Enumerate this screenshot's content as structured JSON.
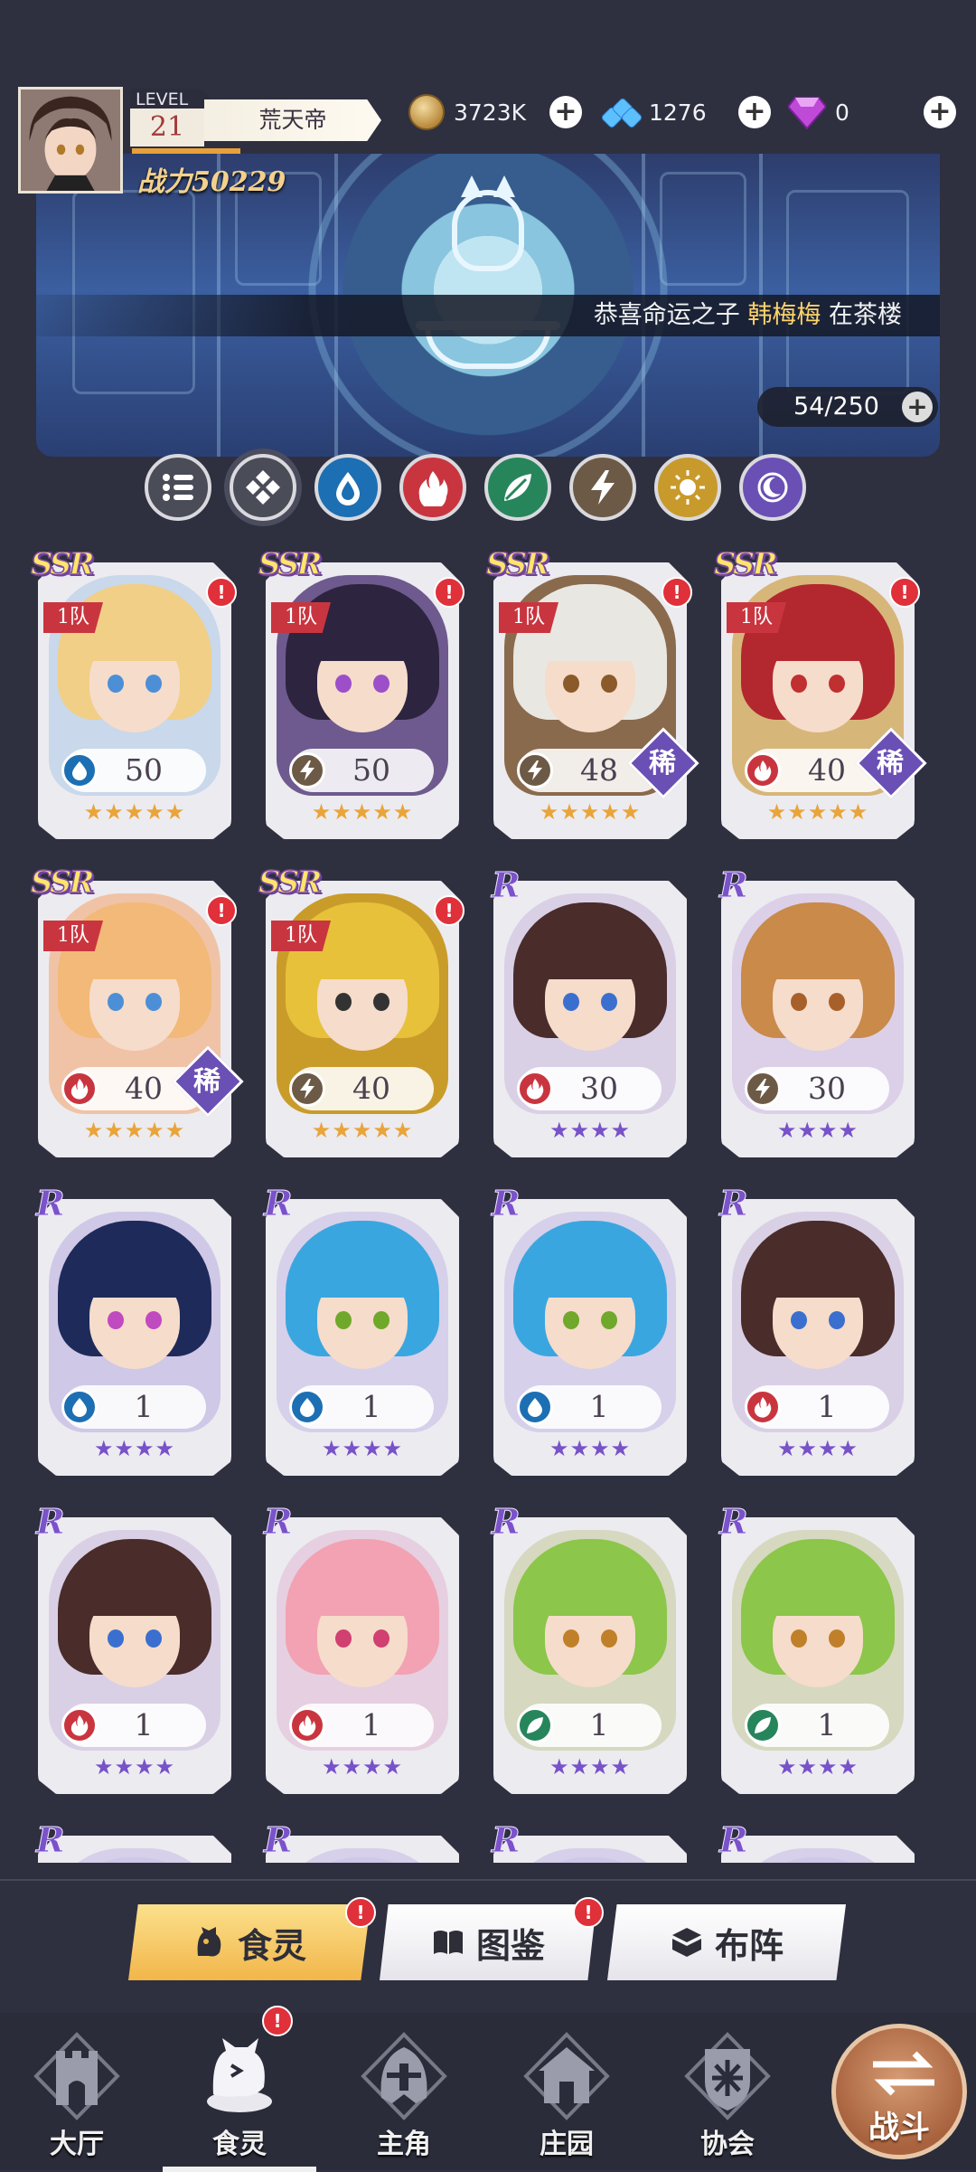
{
  "player": {
    "level_label": "LEVEL",
    "level": "21",
    "name": "荒天帝",
    "power": "战力50229"
  },
  "resources": [
    {
      "icon": "gold-coin-icon",
      "value": "3723K"
    },
    {
      "icon": "blue-crystal-icon",
      "value": "1276"
    },
    {
      "icon": "purple-diamond-icon",
      "value": "0"
    }
  ],
  "announcement": {
    "prefix": "恭喜命运之子 ",
    "highlight": "韩梅梅",
    "suffix": " 在茶楼"
  },
  "collection_count": "54/250",
  "filters": [
    {
      "name": "filter-all",
      "icon": "list-icon",
      "color": "#4a4c58"
    },
    {
      "name": "filter-diamond",
      "icon": "diamond-grid-icon",
      "color": "#4a4c58",
      "active": true
    },
    {
      "name": "filter-water",
      "icon": "water-drop-icon",
      "color": "#1d6fb3"
    },
    {
      "name": "filter-fire",
      "icon": "fire-icon",
      "color": "#c9353f"
    },
    {
      "name": "filter-leaf",
      "icon": "leaf-icon",
      "color": "#27855c"
    },
    {
      "name": "filter-lightning",
      "icon": "lightning-icon",
      "color": "#6d5a46"
    },
    {
      "name": "filter-sun",
      "icon": "sun-icon",
      "color": "#c89a2c"
    },
    {
      "name": "filter-moon",
      "icon": "moon-icon",
      "color": "#6a4fb5"
    }
  ],
  "cards": [
    {
      "rarity": "SSR",
      "team": "1队",
      "alert": "!",
      "level": "50",
      "element": "water",
      "rare": "",
      "stars": "★★★★★",
      "hair": "#f1cf86",
      "eye": "#4c8fd6",
      "bg": "#c9d8ea"
    },
    {
      "rarity": "SSR",
      "team": "1队",
      "alert": "!",
      "level": "50",
      "element": "lightning",
      "rare": "",
      "stars": "★★★★★",
      "hair": "#2d2440",
      "eye": "#9c4fc8",
      "bg": "#6e5a8e"
    },
    {
      "rarity": "SSR",
      "team": "1队",
      "alert": "!",
      "level": "48",
      "element": "lightning",
      "rare": "稀",
      "stars": "★★★★★",
      "hair": "#e9e7e2",
      "eye": "#8a5a2a",
      "bg": "#8a6a4c"
    },
    {
      "rarity": "SSR",
      "team": "1队",
      "alert": "!",
      "level": "40",
      "element": "fire",
      "rare": "稀",
      "stars": "★★★★★",
      "hair": "#b3282e",
      "eye": "#c03030",
      "bg": "#d7b67a"
    },
    {
      "rarity": "SSR",
      "team": "1队",
      "alert": "!",
      "level": "40",
      "element": "fire",
      "rare": "稀",
      "stars": "★★★★★",
      "hair": "#f2b978",
      "eye": "#4c8fd6",
      "bg": "#f0c3a6"
    },
    {
      "rarity": "SSR",
      "team": "1队",
      "alert": "!",
      "level": "40",
      "element": "lightning",
      "rare": "",
      "stars": "★★★★★",
      "hair": "#e7c13a",
      "eye": "#333333",
      "bg": "#c99c2a"
    },
    {
      "rarity": "R",
      "team": "",
      "alert": "",
      "level": "30",
      "element": "fire",
      "rare": "",
      "stars": "★★★★",
      "hair": "#4a2c2a",
      "eye": "#3a6fd0",
      "bg": "#d9d0e6"
    },
    {
      "rarity": "R",
      "team": "",
      "alert": "",
      "level": "30",
      "element": "lightning",
      "rare": "",
      "stars": "★★★★",
      "hair": "#c98a4a",
      "eye": "#a8602a",
      "bg": "#dcd0e8"
    },
    {
      "rarity": "R",
      "team": "",
      "alert": "",
      "level": "1",
      "element": "water",
      "rare": "",
      "stars": "★★★★",
      "hair": "#1e2a5a",
      "eye": "#c04ac0",
      "bg": "#cfc8e6"
    },
    {
      "rarity": "R",
      "team": "",
      "alert": "",
      "level": "1",
      "element": "water",
      "rare": "",
      "stars": "★★★★",
      "hair": "#3aa6e0",
      "eye": "#6fa82a",
      "bg": "#d6d0ea"
    },
    {
      "rarity": "R",
      "team": "",
      "alert": "",
      "level": "1",
      "element": "water",
      "rare": "",
      "stars": "★★★★",
      "hair": "#3aa6e0",
      "eye": "#6fa82a",
      "bg": "#d6d0ea"
    },
    {
      "rarity": "R",
      "team": "",
      "alert": "",
      "level": "1",
      "element": "fire",
      "rare": "",
      "stars": "★★★★",
      "hair": "#4a2c2a",
      "eye": "#3a6fd0",
      "bg": "#d9d0e6"
    },
    {
      "rarity": "R",
      "team": "",
      "alert": "",
      "level": "1",
      "element": "fire",
      "rare": "",
      "stars": "★★★★",
      "hair": "#4a2c2a",
      "eye": "#3a6fd0",
      "bg": "#d9d0e6"
    },
    {
      "rarity": "R",
      "team": "",
      "alert": "",
      "level": "1",
      "element": "fire",
      "rare": "",
      "stars": "★★★★",
      "hair": "#f2a2b2",
      "eye": "#d04070",
      "bg": "#e6cfe0"
    },
    {
      "rarity": "R",
      "team": "",
      "alert": "",
      "level": "1",
      "element": "leaf",
      "rare": "",
      "stars": "★★★★",
      "hair": "#8cc64a",
      "eye": "#c0802a",
      "bg": "#d6d8c0"
    },
    {
      "rarity": "R",
      "team": "",
      "alert": "",
      "level": "1",
      "element": "leaf",
      "rare": "",
      "stars": "★★★★",
      "hair": "#8cc64a",
      "eye": "#c0802a",
      "bg": "#d6d8c0"
    },
    {
      "rarity": "R",
      "team": "",
      "alert": "",
      "level": "",
      "element": "",
      "rare": "",
      "stars": "",
      "hair": "#cfc8e6",
      "eye": "#cfc8e6",
      "bg": "#d6d0ea"
    },
    {
      "rarity": "R",
      "team": "",
      "alert": "",
      "level": "",
      "element": "",
      "rare": "",
      "stars": "",
      "hair": "#cfc8e6",
      "eye": "#cfc8e6",
      "bg": "#d6d0ea"
    },
    {
      "rarity": "R",
      "team": "",
      "alert": "",
      "level": "",
      "element": "",
      "rare": "",
      "stars": "",
      "hair": "#cfc8e6",
      "eye": "#cfc8e6",
      "bg": "#d6d0ea"
    },
    {
      "rarity": "R",
      "team": "",
      "alert": "",
      "level": "",
      "element": "",
      "rare": "",
      "stars": "",
      "hair": "#cfc8e6",
      "eye": "#cfc8e6",
      "bg": "#d6d0ea"
    }
  ],
  "element_colors": {
    "water": "#1d6fb3",
    "fire": "#c9353f",
    "leaf": "#27855c",
    "lightning": "#6d5a46"
  },
  "sub_tabs": [
    {
      "label": "食灵",
      "icon": "cat-spirit-icon",
      "alert": "!",
      "active": true
    },
    {
      "label": "图鉴",
      "icon": "book-icon",
      "alert": "!"
    },
    {
      "label": "布阵",
      "icon": "formation-icon",
      "alert": ""
    }
  ],
  "nav": [
    {
      "label": "大厅",
      "icon": "castle-icon"
    },
    {
      "label": "食灵",
      "icon": "cat-spirit-icon",
      "active": true,
      "alert": "!"
    },
    {
      "label": "主角",
      "icon": "helmet-icon"
    },
    {
      "label": "庄园",
      "icon": "house-icon"
    },
    {
      "label": "协会",
      "icon": "guild-shield-icon"
    }
  ],
  "battle_label": "战斗"
}
